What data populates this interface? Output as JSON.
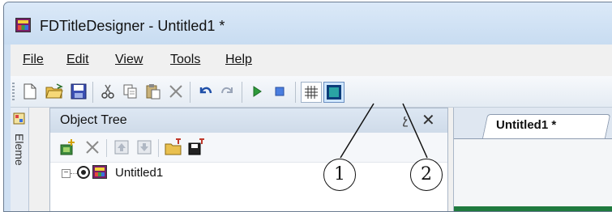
{
  "window": {
    "title": "FDTitleDesigner - Untitled1 *"
  },
  "menu": [
    "File",
    "Edit",
    "View",
    "Tools",
    "Help"
  ],
  "toolbar": {
    "icons": [
      "new-icon",
      "open-icon",
      "save-icon",
      "cut-icon",
      "copy-icon",
      "paste-icon",
      "delete-icon",
      "undo-icon",
      "redo-icon",
      "play-icon",
      "stop-icon",
      "grid-icon",
      "safe-area-icon"
    ]
  },
  "side_strip": {
    "label": "Eleme"
  },
  "object_tree": {
    "title": "Object Tree",
    "pin_glyph": "չ",
    "close_glyph": "✕",
    "root_item": "Untitled1"
  },
  "document": {
    "tab_label": "Untitled1 *"
  },
  "callouts": [
    "1",
    "2"
  ]
}
